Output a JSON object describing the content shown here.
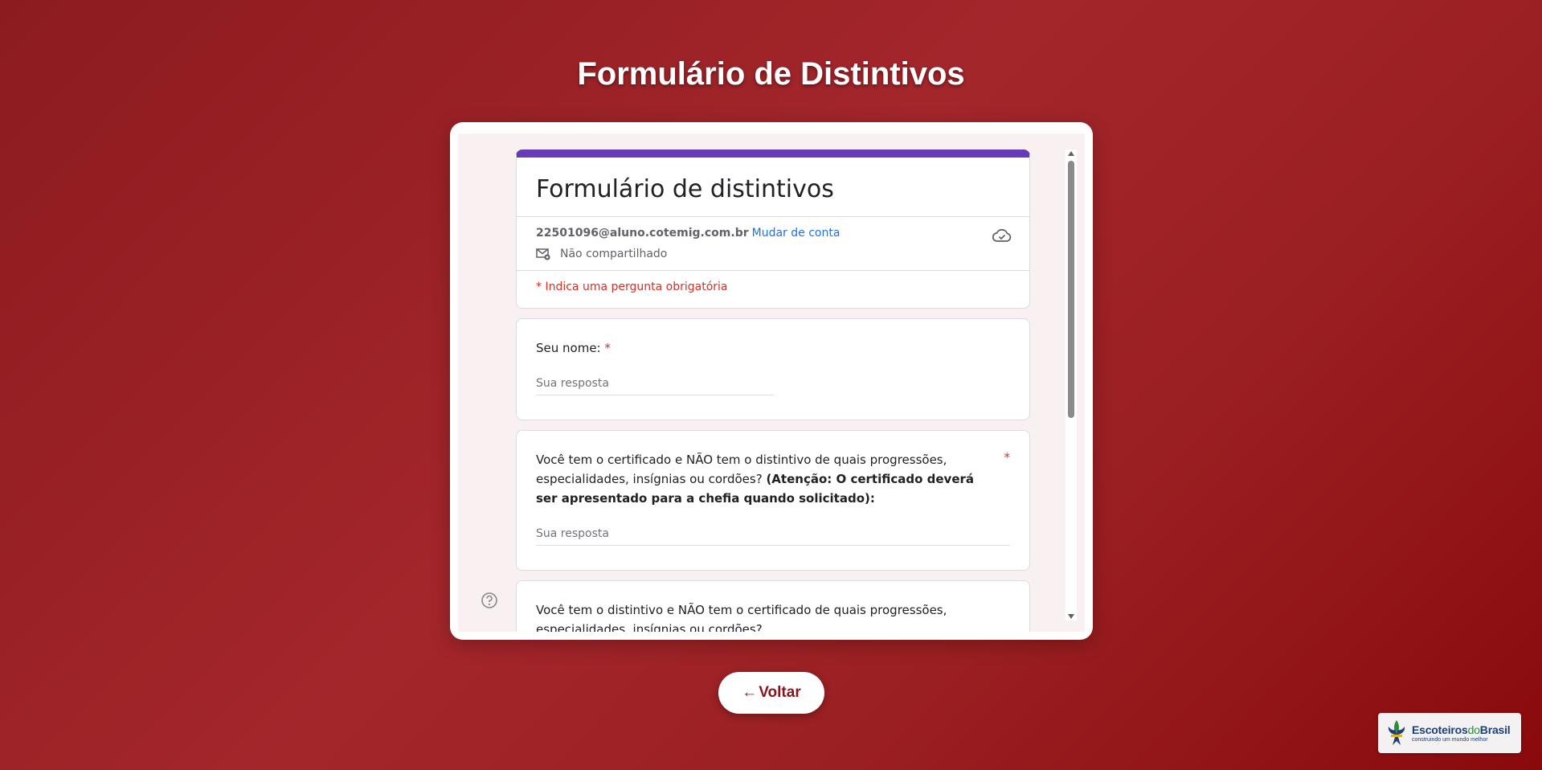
{
  "page": {
    "title": "Formulário de Distintivos",
    "back_arrow": "←",
    "back_label": "Voltar"
  },
  "form": {
    "title": "Formulário de distintivos",
    "account_email": "22501096@aluno.cotemig.com.br",
    "switch_account": "Mudar de conta",
    "not_shared": "Não compartilhado",
    "required_note": "* Indica uma pergunta obrigatória",
    "questions": [
      {
        "label": "Seu nome:",
        "required_mark": "*",
        "placeholder": "Sua resposta"
      },
      {
        "label": "Você tem o certificado e NÃO tem o distintivo de quais progressões, especialidades, insígnias ou cordões?",
        "label_bold": "(Atenção: O certificado deverá ser apresentado para a chefia quando solicitado):",
        "required_mark": "*",
        "placeholder": "Sua resposta"
      },
      {
        "label": "Você tem o distintivo e NÃO tem o certificado de quais progressões, especialidades, insígnias ou cordões?"
      }
    ]
  },
  "logo": {
    "name_part1": "Escoteiros",
    "name_part2": "do",
    "name_part3": "Brasil",
    "tagline": "construindo um mundo melhor"
  },
  "colors": {
    "background": "#9f2328",
    "form_accent": "#673ab7",
    "required": "#d93025",
    "link": "#1a73e8",
    "button_text": "#8b1418"
  },
  "icons": {
    "cloud": "cloud-check-icon",
    "mail": "mail-lock-icon",
    "help": "help-circle-icon",
    "fleur": "fleur-de-lis-icon"
  }
}
